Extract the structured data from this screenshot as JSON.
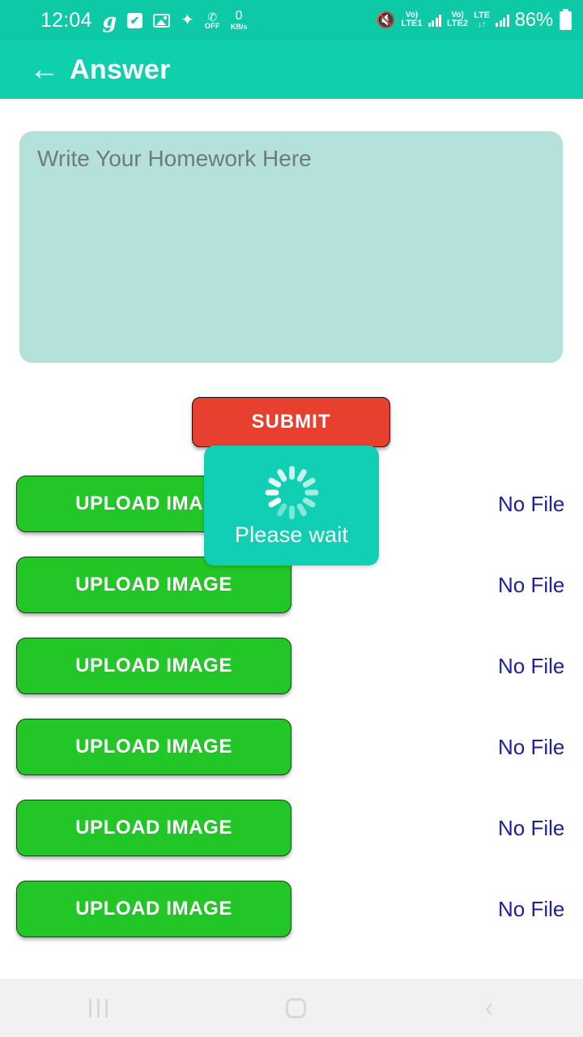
{
  "status_bar": {
    "time": "12:04",
    "app_icon_label": "g",
    "checkbox_glyph": "✔",
    "wand_glyph": "✦",
    "call_off_glyph": "✆",
    "call_off_label": "OFF",
    "data_rate_value": "0",
    "data_rate_unit": "KB/s",
    "mute_glyph": "🔇",
    "sim1_volte": "Vo)",
    "sim1_label": "LTE1",
    "sim2_volte": "Vo)",
    "sim2_label": "LTE2",
    "network_type": "LTE",
    "data_arrows": "↓↑",
    "battery_percent": "86%",
    "background_color": "#0dc9a6"
  },
  "app_bar": {
    "back_glyph": "←",
    "title": "Answer",
    "background_color": "#0fd0ac"
  },
  "answer_field": {
    "placeholder": "Write Your Homework Here",
    "value": "",
    "background_color": "#b4e2da"
  },
  "submit_button": {
    "label": "SUBMIT",
    "color": "#e8402f"
  },
  "upload_rows": [
    {
      "button_label": "UPLOAD IMAGE",
      "file_status": "No File"
    },
    {
      "button_label": "UPLOAD IMAGE",
      "file_status": "No File"
    },
    {
      "button_label": "UPLOAD IMAGE",
      "file_status": "No File"
    },
    {
      "button_label": "UPLOAD IMAGE",
      "file_status": "No File"
    },
    {
      "button_label": "UPLOAD IMAGE",
      "file_status": "No File"
    },
    {
      "button_label": "UPLOAD IMAGE",
      "file_status": "No File"
    }
  ],
  "upload_button_color": "#22c626",
  "file_status_color": "#20209c",
  "wait_dialog": {
    "message": "Please wait",
    "background_color": "#11cfb5",
    "spinner_segments": 12
  },
  "nav_bar": {
    "recents_label": "Recents",
    "home_label": "Home",
    "back_glyph": "‹"
  }
}
